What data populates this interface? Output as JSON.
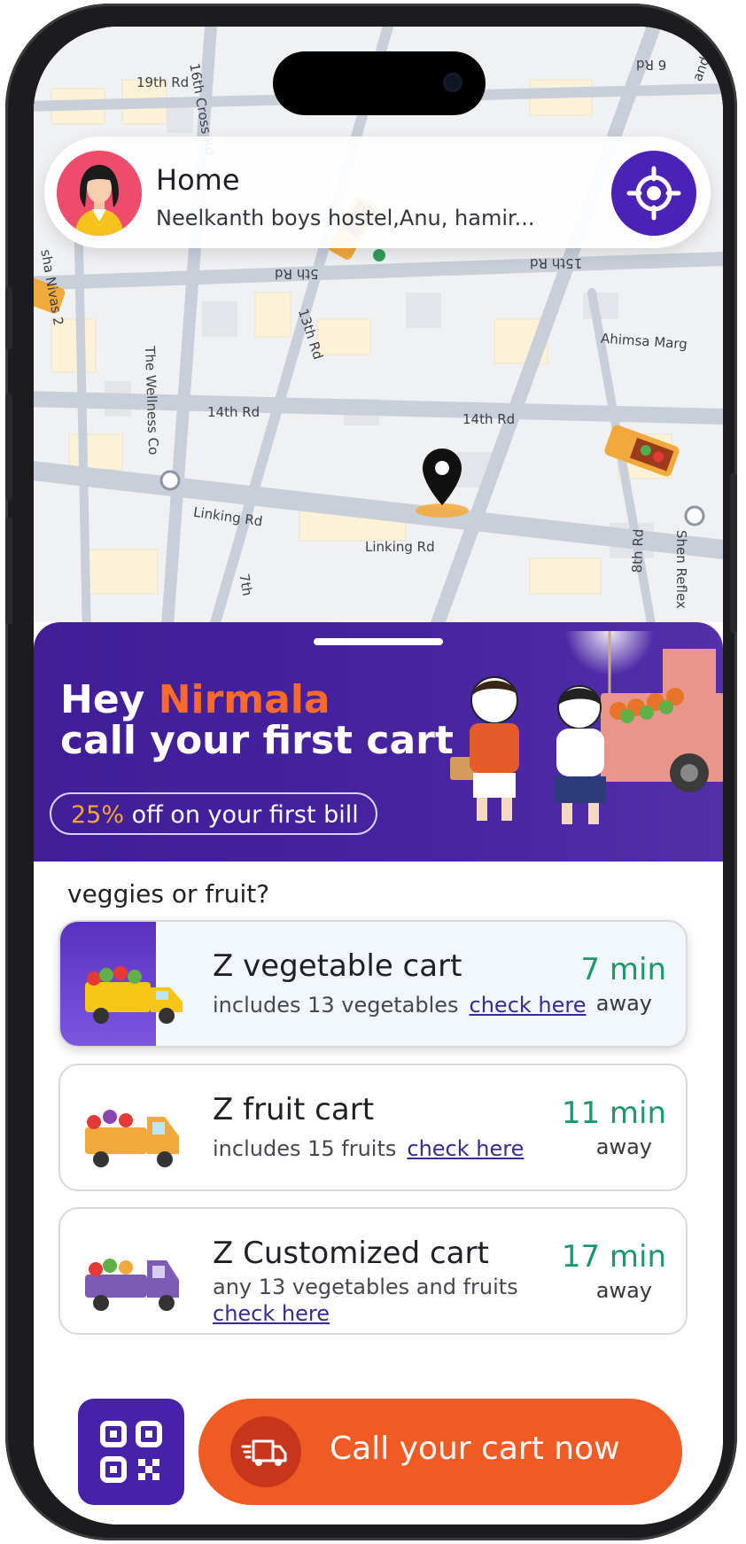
{
  "header": {
    "title": "Home",
    "address": "Neelkanth boys hostel,Anu, hamir..."
  },
  "map": {
    "road_labels": [
      "19th Rd",
      "16th Cross Rd",
      "5th Rd",
      "15th Rd",
      "13th Rd",
      "Ahimsa Marg",
      "The Wellness Co",
      "14th Rd",
      "14th Rd",
      "Linking Rd",
      "Linking Rd",
      "7th",
      "8th Rd",
      "Shen Reflex",
      "andhar Rd",
      "sha Nivas 2",
      "6 Rd"
    ]
  },
  "banner": {
    "greeting": "Hey",
    "name": "Nirmala",
    "headline": "call your first cart",
    "offer_pct": "25%",
    "offer_text": " off on your first bill"
  },
  "section_label": "veggies or fruit?",
  "carts": [
    {
      "title": "Z vegetable cart",
      "subtitle": "includes 13 vegetables",
      "link": "check here",
      "eta": "7 min",
      "away": "away",
      "selected": true
    },
    {
      "title": "Z fruit cart",
      "subtitle": "includes 15 fruits",
      "link": "check here",
      "eta": "11 min",
      "away": "away",
      "selected": false
    },
    {
      "title": "Z Customized cart",
      "subtitle": "any 13 vegetables and fruits",
      "link": "check here",
      "eta": "17 min",
      "away": "away",
      "selected": false
    }
  ],
  "cta": {
    "label": "Call your cart now"
  },
  "colors": {
    "primary": "#4522a8",
    "accent": "#f05a23",
    "eta": "#1a9a6b",
    "offer": "#f6a62d"
  },
  "icons": [
    "avatar",
    "locate-icon",
    "map-pin-icon",
    "qr-code-icon",
    "truck-icon"
  ]
}
